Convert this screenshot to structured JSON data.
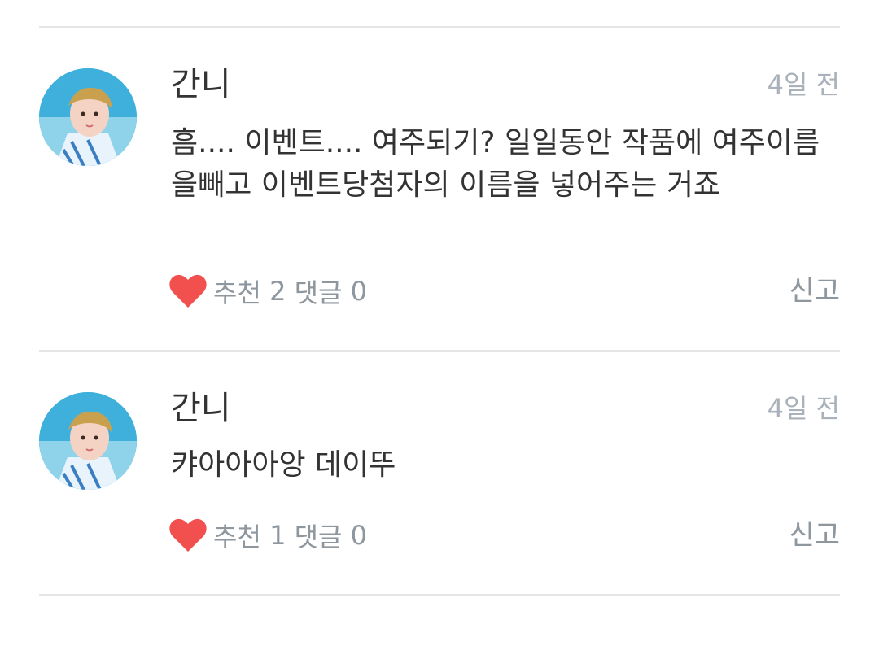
{
  "comments": [
    {
      "author": "간니",
      "time": "4일 전",
      "text": "흠.... 이벤트.... 여주되기? 일일동안 작품에 여주이름을빼고 이벤트당첨자의 이름을 넣어주는 거죠",
      "like_label": "추천",
      "like_count": "2",
      "reply_label": "댓글",
      "reply_count": "0",
      "report_label": "신고"
    },
    {
      "author": "간니",
      "time": "4일 전",
      "text": "캬아아아앙 데이뚜",
      "like_label": "추천",
      "like_count": "1",
      "reply_label": "댓글",
      "reply_count": "0",
      "report_label": "신고"
    }
  ],
  "colors": {
    "heart": "#f2504f",
    "muted_text": "#8e969e",
    "timestamp": "#a9b1ba",
    "divider": "#e6e6e6"
  },
  "icons": {
    "like": "heart-icon"
  }
}
